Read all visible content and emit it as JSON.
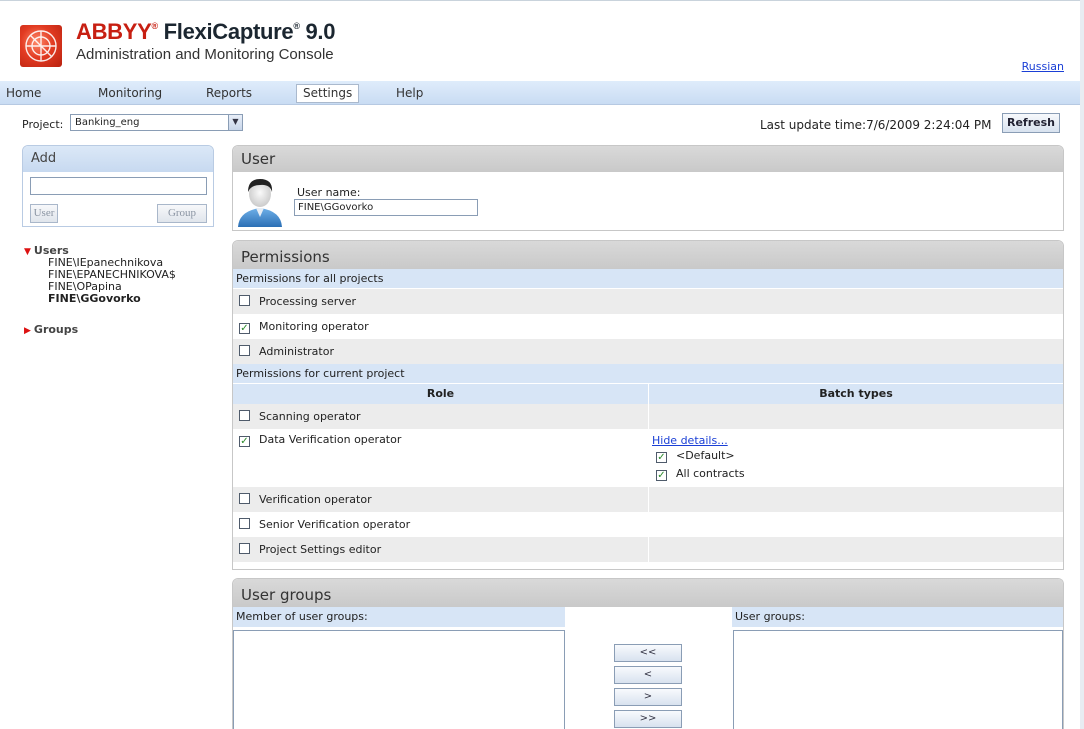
{
  "header": {
    "brand_abbyy": "ABBYY",
    "brand_registered": "®",
    "brand_product": "FlexiCapture",
    "brand_trademark": "®",
    "brand_version": "9.0",
    "subtitle": "Administration and Monitoring Console",
    "language_link": "Russian"
  },
  "menu": {
    "items": [
      {
        "label": "Home"
      },
      {
        "label": "Monitoring"
      },
      {
        "label": "Reports"
      },
      {
        "label": "Settings",
        "active": true
      },
      {
        "label": "Help"
      }
    ]
  },
  "toolbar": {
    "project_label": "Project:",
    "project_value": "Banking_eng",
    "last_update_label": "Last update time:",
    "last_update_value": "7/6/2009 2:24:04 PM",
    "refresh_label": "Refresh"
  },
  "add_panel": {
    "title": "Add",
    "input_value": "",
    "user_button": "User",
    "group_button": "Group"
  },
  "tree": {
    "users_label": "Users",
    "users": [
      "FINE\\IEpanechnikova",
      "FINE\\EPANECHNIKOVA$",
      "FINE\\OPapina",
      "FINE\\GGovorko"
    ],
    "selected_user": "FINE\\GGovorko",
    "groups_label": "Groups"
  },
  "user_panel": {
    "title": "User",
    "user_name_label": "User name:",
    "user_name_value": "FINE\\GGovorko"
  },
  "permissions": {
    "title": "Permissions",
    "all_projects_label": "Permissions for all projects",
    "all_projects": [
      {
        "label": "Processing server",
        "checked": false
      },
      {
        "label": "Monitoring operator",
        "checked": true
      },
      {
        "label": "Administrator",
        "checked": false
      }
    ],
    "current_project_label": "Permissions for current project",
    "role_header": "Role",
    "batch_types_header": "Batch types",
    "roles": [
      {
        "label": "Scanning operator",
        "checked": false
      },
      {
        "label": "Data Verification operator",
        "checked": true
      },
      {
        "label": "Verification operator",
        "checked": false
      },
      {
        "label": "Senior Verification operator",
        "checked": false
      },
      {
        "label": "Project Settings editor",
        "checked": false
      }
    ],
    "hide_details_link": "Hide details...",
    "batch_types": [
      {
        "label": "<Default>",
        "checked": true
      },
      {
        "label": "All contracts",
        "checked": true
      }
    ]
  },
  "user_groups": {
    "title": "User groups",
    "member_of_label": "Member of user groups:",
    "available_label": "User groups:",
    "buttons": [
      "<<",
      "<",
      ">",
      ">>"
    ]
  },
  "colors": {
    "brand_red": "#c71f12",
    "menu_blue": "#d7e5f6",
    "link_blue": "#1a3fd6",
    "check_green": "#2a8a2a"
  }
}
